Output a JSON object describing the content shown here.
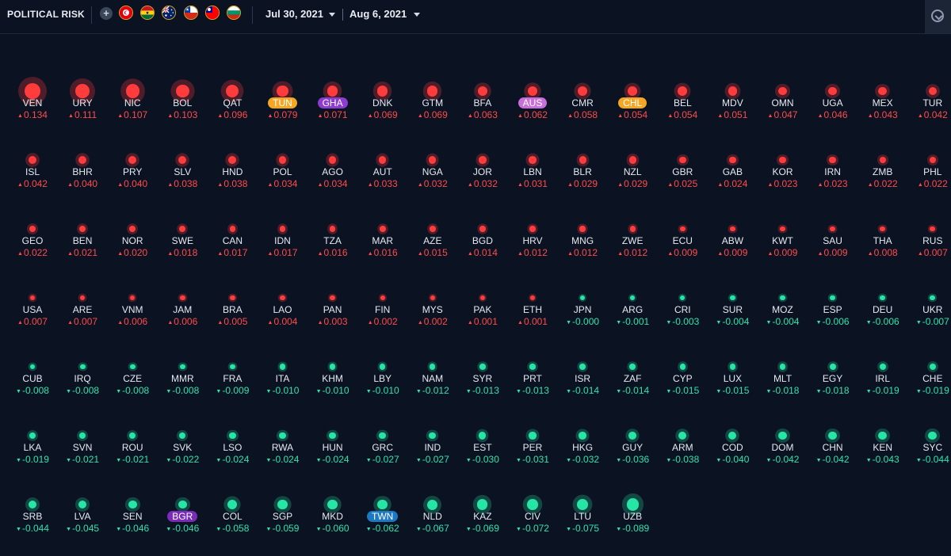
{
  "header": {
    "title": "POLITICAL RISK",
    "add_icon": "plus-icon",
    "flags": [
      "TUN",
      "GHA",
      "AUS",
      "CHL",
      "TWN",
      "BGR"
    ],
    "date_from": "Jul 30, 2021",
    "date_to": "Aug 6, 2021",
    "corner_icon": "settings-icon"
  },
  "colors": {
    "positive": "#ff4a4a",
    "negative": "#2fe3ad",
    "TUN": "#f5a623",
    "GHA": "#8e3bd0",
    "AUS": "#c86fd9",
    "CHL": "#f5a623",
    "BGR": "#7a2bb8",
    "TWN": "#1c78c0"
  },
  "countries": [
    [
      "VEN",
      "0.134"
    ],
    [
      "URY",
      "0.111"
    ],
    [
      "NIC",
      "0.107"
    ],
    [
      "BOL",
      "0.103"
    ],
    [
      "QAT",
      "0.096"
    ],
    [
      "TUN",
      "0.079"
    ],
    [
      "GHA",
      "0.071"
    ],
    [
      "DNK",
      "0.069"
    ],
    [
      "GTM",
      "0.069"
    ],
    [
      "BFA",
      "0.063"
    ],
    [
      "AUS",
      "0.062"
    ],
    [
      "CMR",
      "0.058"
    ],
    [
      "CHL",
      "0.054"
    ],
    [
      "BEL",
      "0.054"
    ],
    [
      "MDV",
      "0.051"
    ],
    [
      "OMN",
      "0.047"
    ],
    [
      "UGA",
      "0.046"
    ],
    [
      "MEX",
      "0.043"
    ],
    [
      "TUR",
      "0.042"
    ],
    [
      "ISL",
      "0.042"
    ],
    [
      "BHR",
      "0.040"
    ],
    [
      "PRY",
      "0.040"
    ],
    [
      "SLV",
      "0.038"
    ],
    [
      "HND",
      "0.038"
    ],
    [
      "POL",
      "0.034"
    ],
    [
      "AGO",
      "0.034"
    ],
    [
      "AUT",
      "0.033"
    ],
    [
      "NGA",
      "0.032"
    ],
    [
      "JOR",
      "0.032"
    ],
    [
      "LBN",
      "0.031"
    ],
    [
      "BLR",
      "0.029"
    ],
    [
      "NZL",
      "0.029"
    ],
    [
      "GBR",
      "0.025"
    ],
    [
      "GAB",
      "0.024"
    ],
    [
      "KOR",
      "0.023"
    ],
    [
      "IRN",
      "0.023"
    ],
    [
      "ZMB",
      "0.022"
    ],
    [
      "PHL",
      "0.022"
    ],
    [
      "GEO",
      "0.022"
    ],
    [
      "BEN",
      "0.021"
    ],
    [
      "NOR",
      "0.020"
    ],
    [
      "SWE",
      "0.018"
    ],
    [
      "CAN",
      "0.017"
    ],
    [
      "IDN",
      "0.017"
    ],
    [
      "TZA",
      "0.016"
    ],
    [
      "MAR",
      "0.016"
    ],
    [
      "AZE",
      "0.015"
    ],
    [
      "BGD",
      "0.014"
    ],
    [
      "HRV",
      "0.012"
    ],
    [
      "MNG",
      "0.012"
    ],
    [
      "ZWE",
      "0.012"
    ],
    [
      "ECU",
      "0.009"
    ],
    [
      "ABW",
      "0.009"
    ],
    [
      "KWT",
      "0.009"
    ],
    [
      "SAU",
      "0.009"
    ],
    [
      "THA",
      "0.008"
    ],
    [
      "RUS",
      "0.007"
    ],
    [
      "USA",
      "0.007"
    ],
    [
      "ARE",
      "0.007"
    ],
    [
      "VNM",
      "0.006"
    ],
    [
      "JAM",
      "0.006"
    ],
    [
      "BRA",
      "0.005"
    ],
    [
      "LAO",
      "0.004"
    ],
    [
      "PAN",
      "0.003"
    ],
    [
      "FIN",
      "0.002"
    ],
    [
      "MYS",
      "0.002"
    ],
    [
      "PAK",
      "0.001"
    ],
    [
      "ETH",
      "0.001"
    ],
    [
      "JPN",
      "-0.000"
    ],
    [
      "ARG",
      "-0.001"
    ],
    [
      "CRI",
      "-0.003"
    ],
    [
      "SUR",
      "-0.004"
    ],
    [
      "MOZ",
      "-0.004"
    ],
    [
      "ESP",
      "-0.006"
    ],
    [
      "DEU",
      "-0.006"
    ],
    [
      "UKR",
      "-0.007"
    ],
    [
      "CUB",
      "-0.008"
    ],
    [
      "IRQ",
      "-0.008"
    ],
    [
      "CZE",
      "-0.008"
    ],
    [
      "MMR",
      "-0.008"
    ],
    [
      "FRA",
      "-0.009"
    ],
    [
      "ITA",
      "-0.010"
    ],
    [
      "KHM",
      "-0.010"
    ],
    [
      "LBY",
      "-0.010"
    ],
    [
      "NAM",
      "-0.012"
    ],
    [
      "SYR",
      "-0.013"
    ],
    [
      "PRT",
      "-0.013"
    ],
    [
      "ISR",
      "-0.014"
    ],
    [
      "ZAF",
      "-0.014"
    ],
    [
      "CYP",
      "-0.015"
    ],
    [
      "LUX",
      "-0.015"
    ],
    [
      "MLT",
      "-0.018"
    ],
    [
      "EGY",
      "-0.018"
    ],
    [
      "IRL",
      "-0.019"
    ],
    [
      "CHE",
      "-0.019"
    ],
    [
      "LKA",
      "-0.019"
    ],
    [
      "SVN",
      "-0.021"
    ],
    [
      "ROU",
      "-0.021"
    ],
    [
      "SVK",
      "-0.022"
    ],
    [
      "LSO",
      "-0.024"
    ],
    [
      "RWA",
      "-0.024"
    ],
    [
      "HUN",
      "-0.024"
    ],
    [
      "GRC",
      "-0.027"
    ],
    [
      "IND",
      "-0.027"
    ],
    [
      "EST",
      "-0.030"
    ],
    [
      "PER",
      "-0.031"
    ],
    [
      "HKG",
      "-0.032"
    ],
    [
      "GUY",
      "-0.036"
    ],
    [
      "ARM",
      "-0.038"
    ],
    [
      "COD",
      "-0.040"
    ],
    [
      "DOM",
      "-0.042"
    ],
    [
      "CHN",
      "-0.042"
    ],
    [
      "KEN",
      "-0.043"
    ],
    [
      "SYC",
      "-0.044"
    ],
    [
      "SRB",
      "-0.044"
    ],
    [
      "LVA",
      "-0.045"
    ],
    [
      "SEN",
      "-0.046"
    ],
    [
      "BGR",
      "-0.046"
    ],
    [
      "COL",
      "-0.058"
    ],
    [
      "SGP",
      "-0.059"
    ],
    [
      "MKD",
      "-0.060"
    ],
    [
      "TWN",
      "-0.062"
    ],
    [
      "NLD",
      "-0.067"
    ],
    [
      "KAZ",
      "-0.069"
    ],
    [
      "CIV",
      "-0.072"
    ],
    [
      "LTU",
      "-0.075"
    ],
    [
      "UZB",
      "-0.089"
    ]
  ],
  "display": {
    "VEN": "▲0.134",
    "URY": "▲0.111",
    "NIC": "▲0.107",
    "BOL": "▲0.103",
    "QAT": "▲0.096",
    "TUN": "▲0.079",
    "GHA": "▲0.071",
    "DNK": "▲0.069",
    "GTM": "▲0.069",
    "BFA": "▲0.063",
    "AUS": "▲0.062",
    "CMR": "▲0.058",
    "CHL": "▲0.054",
    "BEL": "▲0.054",
    "MDV": "▲0.051",
    "OMN": "▲0.047",
    "UGA": "▲0.046",
    "MEX": "▲0.043",
    "TUR": "▲0.042"
  }
}
